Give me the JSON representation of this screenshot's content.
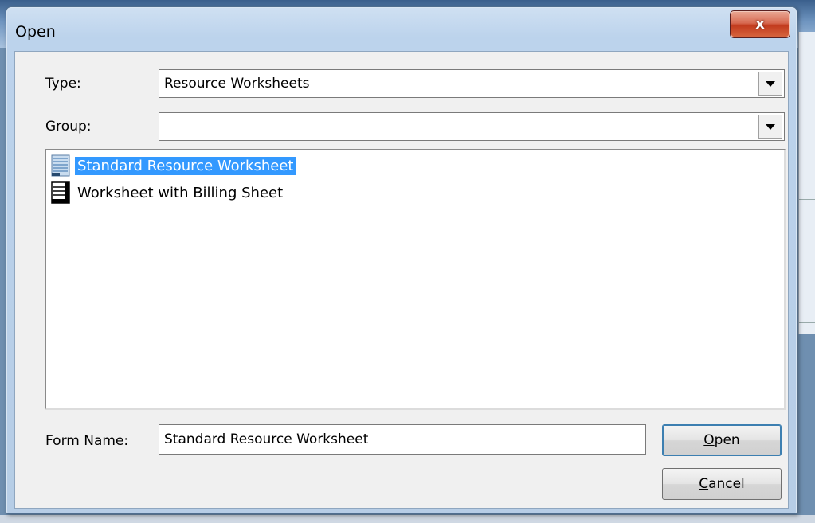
{
  "window": {
    "title": "Open",
    "close_glyph": "x"
  },
  "type": {
    "label": "Type:",
    "value": "Resource Worksheets"
  },
  "group": {
    "label": "Group:",
    "value": ""
  },
  "list": {
    "items": [
      {
        "label": "Standard Resource Worksheet",
        "icon": "worksheet-icon",
        "selected": true
      },
      {
        "label": "Worksheet with Billing Sheet",
        "icon": "billing-sheet-icon",
        "selected": false
      }
    ]
  },
  "form_name": {
    "label": "Form Name:",
    "value": "Standard Resource Worksheet"
  },
  "buttons": {
    "open": {
      "accel": "O",
      "rest": "pen"
    },
    "cancel": {
      "accel": "C",
      "rest": "ancel"
    }
  },
  "colors": {
    "selection": "#3399ff",
    "close": "#c23b1e"
  }
}
